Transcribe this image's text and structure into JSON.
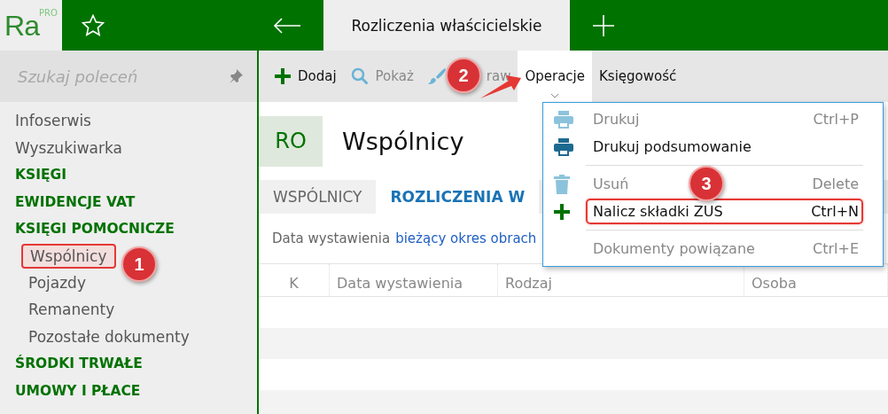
{
  "logo": {
    "mark": "Ra",
    "edition": "PRO"
  },
  "window": {
    "tab_title": "Rozliczenia właścicielskie"
  },
  "sidebar": {
    "search": {
      "placeholder": "Szukaj poleceń"
    },
    "items": [
      {
        "label": "Infoserwis",
        "kind": "link"
      },
      {
        "label": "Wyszukiwarka",
        "kind": "link"
      },
      {
        "label": "KSIĘGI",
        "kind": "section"
      },
      {
        "label": "EWIDENCJE VAT",
        "kind": "section"
      },
      {
        "label": "KSIĘGI POMOCNICZE",
        "kind": "section",
        "children": [
          {
            "label": "Wspólnicy",
            "marked": true
          },
          {
            "label": "Pojazdy",
            "marked": false
          },
          {
            "label": "Remanenty",
            "marked": false
          },
          {
            "label": "Pozostałe dokumenty",
            "marked": false
          }
        ]
      },
      {
        "label": "ŚRODKI TRWAŁE",
        "kind": "section"
      },
      {
        "label": "UMOWY I PŁACE",
        "kind": "section"
      }
    ]
  },
  "toolbar": [
    {
      "label": "Dodaj",
      "kind": "add",
      "disabled": false,
      "selected": false
    },
    {
      "label": "Pokaż",
      "kind": "view",
      "disabled": true,
      "selected": false
    },
    {
      "label": "raw",
      "kind": "edit",
      "disabled": true,
      "selected": false
    },
    {
      "label": "Operacje",
      "kind": "dropdown",
      "disabled": false,
      "selected": true
    },
    {
      "label": "Księgowość",
      "kind": "plain",
      "disabled": false,
      "selected": false
    }
  ],
  "header": {
    "badge": "RO",
    "title": "Wspólnicy"
  },
  "tabs": [
    {
      "label": "WSPÓLNICY",
      "selected": false
    },
    {
      "label": "ROZLICZENIA W",
      "selected": true
    }
  ],
  "filter": {
    "label": "Data wystawienia",
    "value": "bieżący okres obrach"
  },
  "table": {
    "columns": [
      "K",
      "Data wystawienia",
      "Rodzaj",
      "Osoba"
    ]
  },
  "menu": [
    {
      "kind": "print",
      "label": "Drukuj",
      "shortcut": "Ctrl+P",
      "disabled": true,
      "marked": false
    },
    {
      "kind": "print",
      "label": "Drukuj podsumowanie",
      "disabled": false,
      "marked": false
    },
    {
      "kind": "separator"
    },
    {
      "kind": "delete",
      "label": "Usuń",
      "shortcut": "Delete",
      "disabled": true,
      "marked": false
    },
    {
      "kind": "add",
      "label": "Nalicz składki ZUS",
      "shortcut": "Ctrl+N",
      "disabled": false,
      "marked": true
    },
    {
      "kind": "separator"
    },
    {
      "kind": "plain",
      "label": "Dokumenty powiązane",
      "shortcut": "Ctrl+E",
      "disabled": true,
      "marked": false
    }
  ],
  "annotations": [
    {
      "label": "1"
    },
    {
      "label": "2"
    },
    {
      "label": "3"
    }
  ]
}
